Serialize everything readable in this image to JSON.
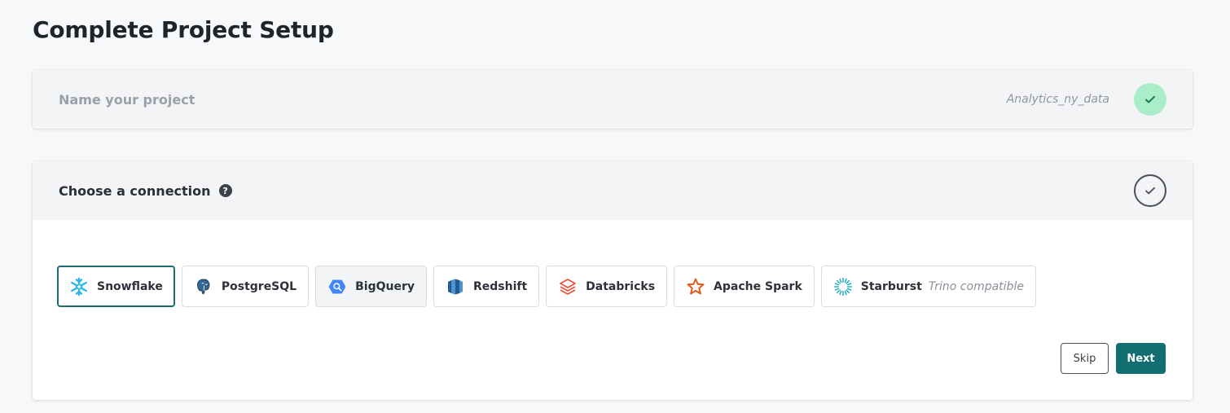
{
  "page": {
    "title": "Complete Project Setup"
  },
  "step_name": {
    "title": "Name your project",
    "value": "Analytics_ny_data",
    "status": "complete"
  },
  "step_connection": {
    "title": "Choose a connection",
    "help_glyph": "?",
    "status": "pending",
    "options": [
      {
        "label": "Snowflake",
        "icon": "snowflake-icon",
        "selected": true
      },
      {
        "label": "PostgreSQL",
        "icon": "postgresql-icon"
      },
      {
        "label": "BigQuery",
        "icon": "bigquery-icon"
      },
      {
        "label": "Redshift",
        "icon": "redshift-icon"
      },
      {
        "label": "Databricks",
        "icon": "databricks-icon"
      },
      {
        "label": "Apache Spark",
        "icon": "apache-spark-icon"
      },
      {
        "label": "Starburst",
        "sublabel": "Trino compatible",
        "icon": "starburst-icon"
      }
    ],
    "buttons": {
      "skip": "Skip",
      "next": "Next"
    }
  },
  "colors": {
    "accent": "#126e70",
    "success_bg": "#a9edc9",
    "success_check": "#1c7a54"
  }
}
